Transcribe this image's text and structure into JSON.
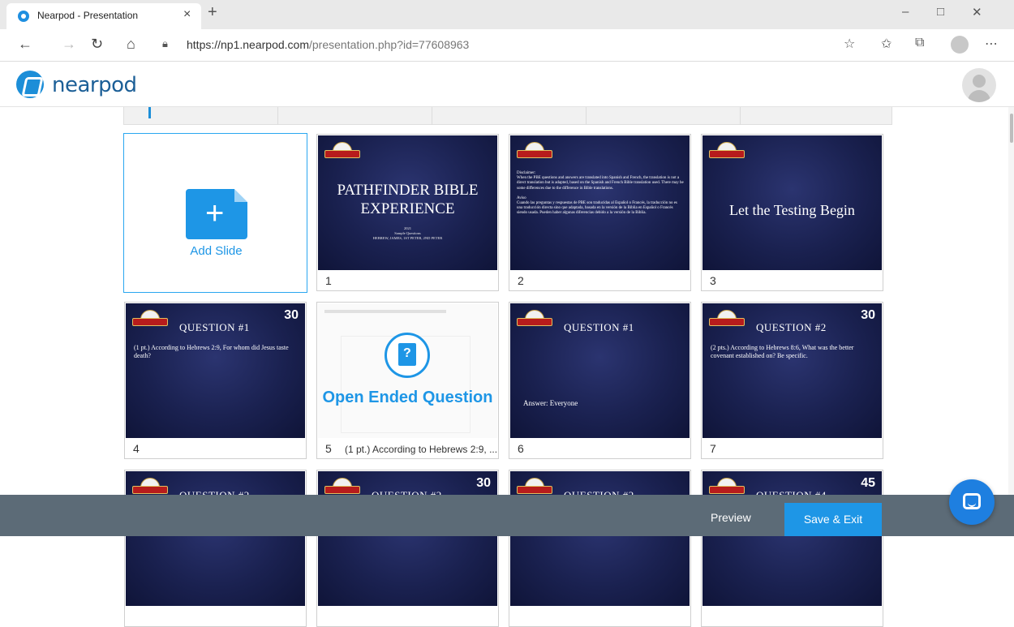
{
  "browser": {
    "tab_title": "Nearpod - Presentation",
    "tab_close": "×",
    "new_tab": "+",
    "url_host": "https://np1.nearpod.com",
    "url_path": "/presentation.php?id=77608963",
    "win_minimize": "–",
    "win_restore": "□",
    "win_close": "✕"
  },
  "app": {
    "logo_text": "nearpod",
    "brand_color": "#1e96e6"
  },
  "add_slide": {
    "label": "Add Slide",
    "plus": "+"
  },
  "slides": {
    "s1": {
      "number": "1",
      "title": "PATHFINDER BIBLE EXPERIENCE",
      "sub1": "2021",
      "sub2": "Sample Questions",
      "sub3": "HEBREW, JAMES, 1ST PETER, 2ND PETER"
    },
    "s2": {
      "number": "2",
      "head1": "Disclaimer:",
      "body1": "When the PBE questions and answers are translated into Spanish and French, the translation is not a direct translation but is adapted, based on the Spanish and French Bible translation used. There may be some differences due to the difference in Bible translations.",
      "head2": "Aviso",
      "body2": "Cuando las preguntas y respuestas de PBE son traducidas al Español o Francés, la traducción no es una traducción directa sino que adaptada, basada en la versión de la Biblia en Español o Francés siendo usada. Pueden haber algunas diferencias debido a la versión de la Biblia."
    },
    "s3": {
      "number": "3",
      "title": "Let the Testing Begin"
    },
    "s4": {
      "number": "4",
      "points": "30",
      "title": "QUESTION #1",
      "text": "(1 pt.) According to Hebrews 2:9, For whom did Jesus taste death?"
    },
    "s5": {
      "number": "5",
      "label": "Open Ended Question",
      "caption": "(1 pt.) According to Hebrews 2:9, ..."
    },
    "s6": {
      "number": "6",
      "title": "QUESTION #1",
      "answer": "Answer:   Everyone"
    },
    "s7": {
      "number": "7",
      "points": "30",
      "title": "QUESTION #2",
      "text": "(2 pts.) According to Hebrews 8:6, What was the better covenant established on? Be specific."
    },
    "s8": {
      "title": "QUESTION #2"
    },
    "s9": {
      "title": "QUESTION #2",
      "points": "30"
    },
    "s10": {
      "title": "QUESTION #2"
    },
    "s11": {
      "title": "QUESTION #4",
      "points": "45"
    }
  },
  "footer": {
    "preview": "Preview",
    "save_exit": "Save & Exit"
  }
}
